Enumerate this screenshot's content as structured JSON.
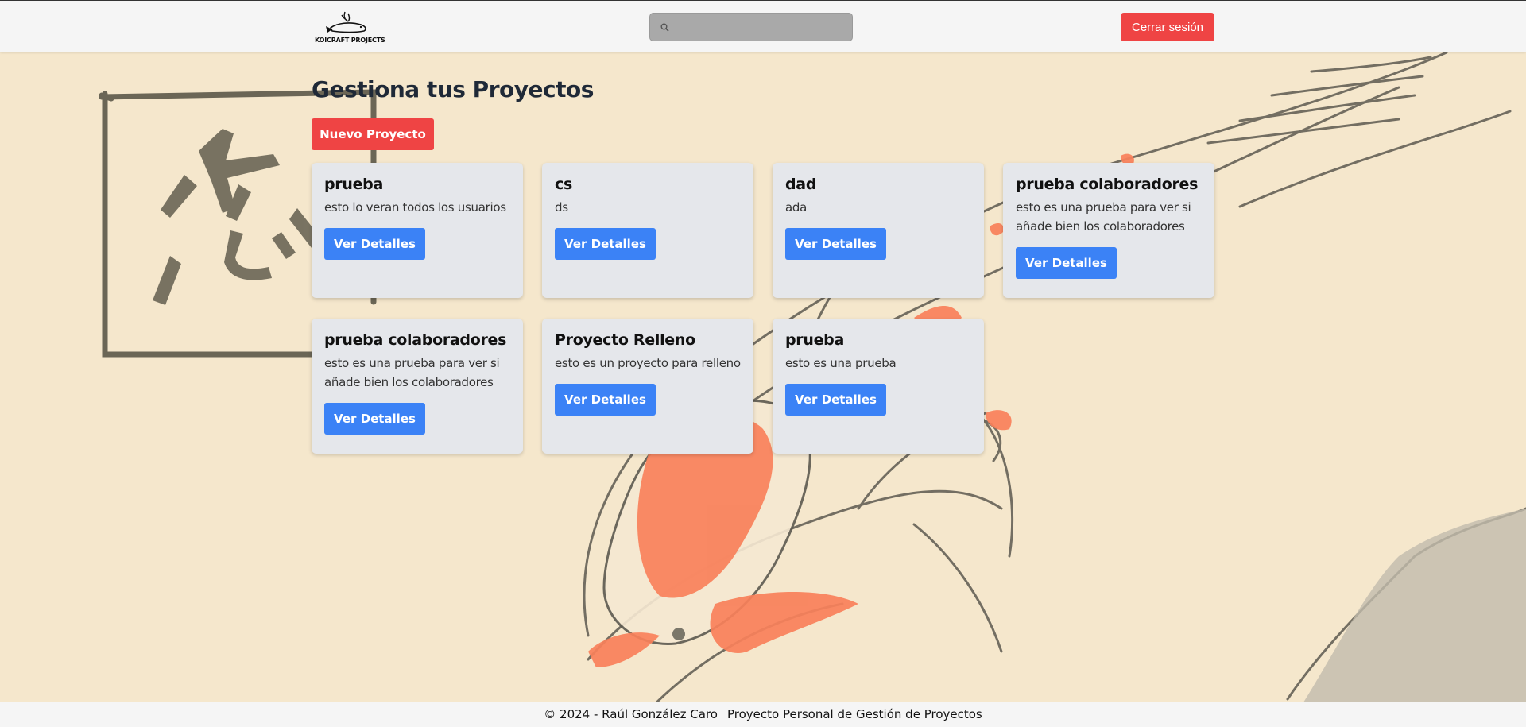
{
  "header": {
    "logo_text": "KOICRAFT PROJECTS",
    "search": {
      "value": "",
      "placeholder": ""
    },
    "logout_label": "Cerrar sesión"
  },
  "main": {
    "title": "Gestiona tus Proyectos",
    "new_project_label": "Nuevo Proyecto",
    "projects": [
      {
        "title": "prueba",
        "description": "esto lo veran todos los usuarios",
        "button": "Ver Detalles"
      },
      {
        "title": "cs",
        "description": "ds",
        "button": "Ver Detalles"
      },
      {
        "title": "dad",
        "description": "ada",
        "button": "Ver Detalles"
      },
      {
        "title": "prueba colaboradores",
        "description": "esto es una prueba para ver si añade bien los colaboradores",
        "button": "Ver Detalles"
      },
      {
        "title": "prueba colaboradores",
        "description": "esto es una prueba para ver si añade bien los colaboradores",
        "button": "Ver Detalles"
      },
      {
        "title": "Proyecto Relleno",
        "description": "esto es un proyecto para relleno",
        "button": "Ver Detalles"
      },
      {
        "title": "prueba",
        "description": "esto es una prueba",
        "button": "Ver Detalles"
      }
    ]
  },
  "footer": {
    "copyright": "© 2024 - Raúl González Caro",
    "tagline": "Proyecto Personal de Gestión de Proyectos"
  },
  "colors": {
    "background": "#f5e7cc",
    "danger": "#ef4444",
    "primary": "#3b82f6",
    "card": "#e5e7eb",
    "koi_orange": "#f9805a"
  }
}
